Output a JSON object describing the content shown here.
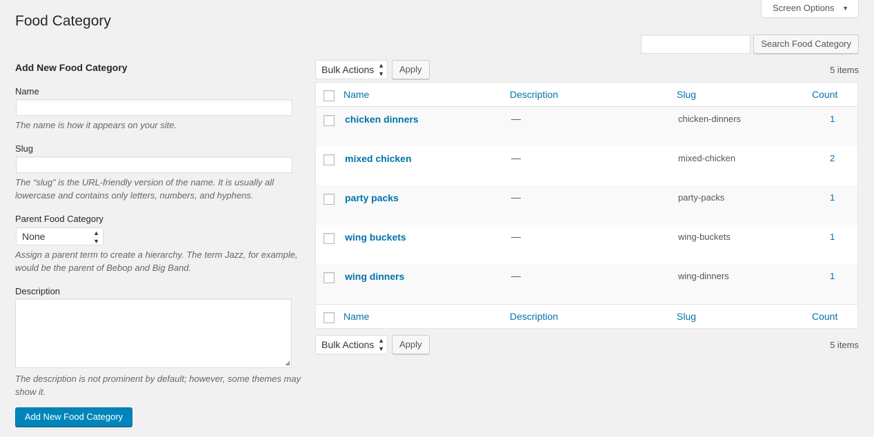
{
  "header": {
    "title": "Food Category",
    "screen_options_label": "Screen Options",
    "search_button": "Search Food Category",
    "search_value": ""
  },
  "form": {
    "heading": "Add New Food Category",
    "name_label": "Name",
    "name_help": "The name is how it appears on your site.",
    "slug_label": "Slug",
    "slug_help": "The “slug” is the URL-friendly version of the name. It is usually all lowercase and contains only letters, numbers, and hyphens.",
    "parent_label": "Parent Food Category",
    "parent_selected": "None",
    "parent_help": "Assign a parent term to create a hierarchy. The term Jazz, for example, would be the parent of Bebop and Big Band.",
    "description_label": "Description",
    "description_help": "The description is not prominent by default; however, some themes may show it.",
    "submit_label": "Add New Food Category"
  },
  "table": {
    "bulk_actions": "Bulk Actions",
    "apply": "Apply",
    "items_count": "5 items",
    "columns": [
      "Name",
      "Description",
      "Slug",
      "Count"
    ],
    "rows": [
      {
        "name": "chicken dinners",
        "description": "—",
        "slug": "chicken-dinners",
        "count": "1"
      },
      {
        "name": "mixed chicken",
        "description": "—",
        "slug": "mixed-chicken",
        "count": "2"
      },
      {
        "name": "party packs",
        "description": "—",
        "slug": "party-packs",
        "count": "1"
      },
      {
        "name": "wing buckets",
        "description": "—",
        "slug": "wing-buckets",
        "count": "1"
      },
      {
        "name": "wing dinners",
        "description": "—",
        "slug": "wing-dinners",
        "count": "1"
      }
    ]
  },
  "icons": {
    "screen_options_arrow": "▼",
    "select_arrows": "▲▼"
  },
  "colors": {
    "link": "#0073aa",
    "primary_button": "#0085ba",
    "background": "#f1f1f1"
  }
}
